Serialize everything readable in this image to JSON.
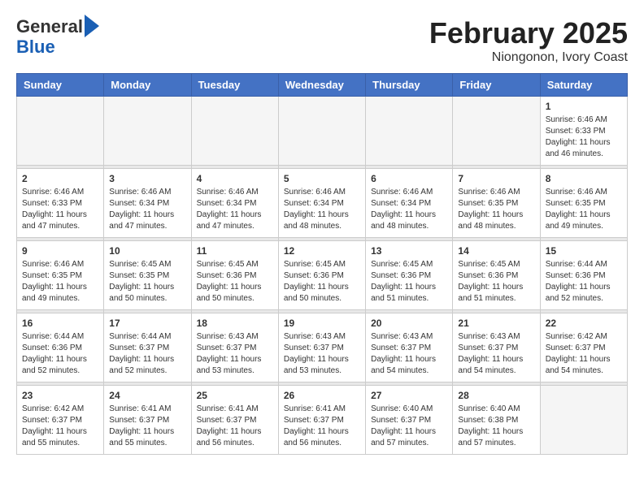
{
  "header": {
    "logo_line1": "General",
    "logo_line2": "Blue",
    "title": "February 2025",
    "subtitle": "Niongonon, Ivory Coast"
  },
  "weekdays": [
    "Sunday",
    "Monday",
    "Tuesday",
    "Wednesday",
    "Thursday",
    "Friday",
    "Saturday"
  ],
  "weeks": [
    [
      {
        "day": "",
        "info": ""
      },
      {
        "day": "",
        "info": ""
      },
      {
        "day": "",
        "info": ""
      },
      {
        "day": "",
        "info": ""
      },
      {
        "day": "",
        "info": ""
      },
      {
        "day": "",
        "info": ""
      },
      {
        "day": "1",
        "info": "Sunrise: 6:46 AM\nSunset: 6:33 PM\nDaylight: 11 hours\nand 46 minutes."
      }
    ],
    [
      {
        "day": "2",
        "info": "Sunrise: 6:46 AM\nSunset: 6:33 PM\nDaylight: 11 hours\nand 47 minutes."
      },
      {
        "day": "3",
        "info": "Sunrise: 6:46 AM\nSunset: 6:34 PM\nDaylight: 11 hours\nand 47 minutes."
      },
      {
        "day": "4",
        "info": "Sunrise: 6:46 AM\nSunset: 6:34 PM\nDaylight: 11 hours\nand 47 minutes."
      },
      {
        "day": "5",
        "info": "Sunrise: 6:46 AM\nSunset: 6:34 PM\nDaylight: 11 hours\nand 48 minutes."
      },
      {
        "day": "6",
        "info": "Sunrise: 6:46 AM\nSunset: 6:34 PM\nDaylight: 11 hours\nand 48 minutes."
      },
      {
        "day": "7",
        "info": "Sunrise: 6:46 AM\nSunset: 6:35 PM\nDaylight: 11 hours\nand 48 minutes."
      },
      {
        "day": "8",
        "info": "Sunrise: 6:46 AM\nSunset: 6:35 PM\nDaylight: 11 hours\nand 49 minutes."
      }
    ],
    [
      {
        "day": "9",
        "info": "Sunrise: 6:46 AM\nSunset: 6:35 PM\nDaylight: 11 hours\nand 49 minutes."
      },
      {
        "day": "10",
        "info": "Sunrise: 6:45 AM\nSunset: 6:35 PM\nDaylight: 11 hours\nand 50 minutes."
      },
      {
        "day": "11",
        "info": "Sunrise: 6:45 AM\nSunset: 6:36 PM\nDaylight: 11 hours\nand 50 minutes."
      },
      {
        "day": "12",
        "info": "Sunrise: 6:45 AM\nSunset: 6:36 PM\nDaylight: 11 hours\nand 50 minutes."
      },
      {
        "day": "13",
        "info": "Sunrise: 6:45 AM\nSunset: 6:36 PM\nDaylight: 11 hours\nand 51 minutes."
      },
      {
        "day": "14",
        "info": "Sunrise: 6:45 AM\nSunset: 6:36 PM\nDaylight: 11 hours\nand 51 minutes."
      },
      {
        "day": "15",
        "info": "Sunrise: 6:44 AM\nSunset: 6:36 PM\nDaylight: 11 hours\nand 52 minutes."
      }
    ],
    [
      {
        "day": "16",
        "info": "Sunrise: 6:44 AM\nSunset: 6:36 PM\nDaylight: 11 hours\nand 52 minutes."
      },
      {
        "day": "17",
        "info": "Sunrise: 6:44 AM\nSunset: 6:37 PM\nDaylight: 11 hours\nand 52 minutes."
      },
      {
        "day": "18",
        "info": "Sunrise: 6:43 AM\nSunset: 6:37 PM\nDaylight: 11 hours\nand 53 minutes."
      },
      {
        "day": "19",
        "info": "Sunrise: 6:43 AM\nSunset: 6:37 PM\nDaylight: 11 hours\nand 53 minutes."
      },
      {
        "day": "20",
        "info": "Sunrise: 6:43 AM\nSunset: 6:37 PM\nDaylight: 11 hours\nand 54 minutes."
      },
      {
        "day": "21",
        "info": "Sunrise: 6:43 AM\nSunset: 6:37 PM\nDaylight: 11 hours\nand 54 minutes."
      },
      {
        "day": "22",
        "info": "Sunrise: 6:42 AM\nSunset: 6:37 PM\nDaylight: 11 hours\nand 54 minutes."
      }
    ],
    [
      {
        "day": "23",
        "info": "Sunrise: 6:42 AM\nSunset: 6:37 PM\nDaylight: 11 hours\nand 55 minutes."
      },
      {
        "day": "24",
        "info": "Sunrise: 6:41 AM\nSunset: 6:37 PM\nDaylight: 11 hours\nand 55 minutes."
      },
      {
        "day": "25",
        "info": "Sunrise: 6:41 AM\nSunset: 6:37 PM\nDaylight: 11 hours\nand 56 minutes."
      },
      {
        "day": "26",
        "info": "Sunrise: 6:41 AM\nSunset: 6:37 PM\nDaylight: 11 hours\nand 56 minutes."
      },
      {
        "day": "27",
        "info": "Sunrise: 6:40 AM\nSunset: 6:37 PM\nDaylight: 11 hours\nand 57 minutes."
      },
      {
        "day": "28",
        "info": "Sunrise: 6:40 AM\nSunset: 6:38 PM\nDaylight: 11 hours\nand 57 minutes."
      },
      {
        "day": "",
        "info": ""
      }
    ]
  ]
}
